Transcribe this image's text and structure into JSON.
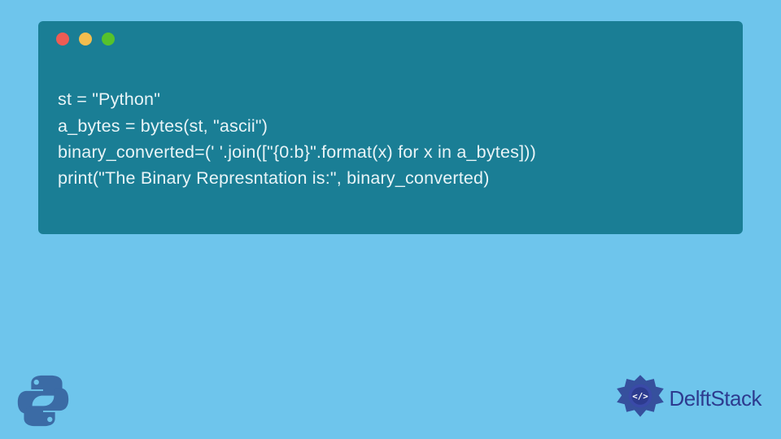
{
  "code": {
    "lines": [
      "st = \"Python\"",
      "a_bytes = bytes(st, \"ascii\")",
      "binary_converted=(' '.join([\"{0:b}\".format(x) for x in a_bytes]))",
      "print(\"The Binary Represntation is:\", binary_converted)"
    ]
  },
  "brand": {
    "name": "DelftStack"
  },
  "colors": {
    "background": "#6ec5ec",
    "window": "#1a7e95",
    "text": "#e8f4f7",
    "brand_text": "#2d3b8f"
  }
}
